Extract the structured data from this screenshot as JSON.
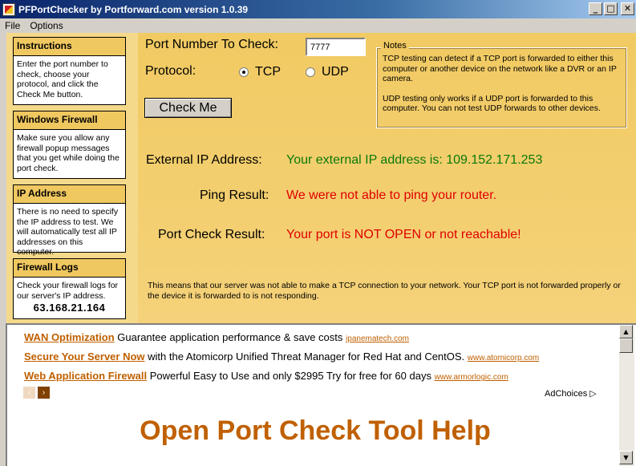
{
  "window": {
    "title": "PFPortChecker by Portforward.com version 1.0.39",
    "minimize": "_",
    "maximize": "□",
    "close": "✕"
  },
  "menu": [
    "File",
    "Options"
  ],
  "sidebar": [
    {
      "heading": "Instructions",
      "body": "Enter the port number to check, choose your protocol, and click the Check Me button."
    },
    {
      "heading": "Windows Firewall",
      "body": "Make sure you allow any firewall popup messages that you get while doing the port check."
    },
    {
      "heading": "IP Address",
      "body": "There is no need to specify the IP address to test. We will automatically test all IP addresses on this computer."
    },
    {
      "heading": "Firewall Logs",
      "body": "Check your firewall logs for our server's IP address.",
      "ip": "63.168.21.164"
    }
  ],
  "form": {
    "port_label": "Port Number To Check:",
    "port_value": "7777",
    "protocol_label": "Protocol:",
    "tcp_label": "TCP",
    "udp_label": "UDP",
    "selected_protocol": "TCP",
    "check_button": "Check Me"
  },
  "notes": {
    "title": "Notes",
    "text1": "TCP testing can detect if a TCP port is forwarded to either this computer or another device on the network like a DVR or an IP camera.",
    "text2": "UDP testing only works if a UDP port is forwarded to this computer. You can not test UDP forwards to other devices."
  },
  "results": {
    "external_ip_label": "External IP Address:",
    "external_ip_value": "Your external IP address is: 109.152.171.253",
    "ping_label": "Ping Result:",
    "ping_value": "We were not able to ping your router.",
    "port_label": "Port Check Result:",
    "port_value": "Your port is NOT OPEN or not reachable!",
    "footer": "This means that our server was not able to make a TCP connection to your network. Your TCP port is not forwarded properly or the device it is forwarded to is not responding."
  },
  "ads": [
    {
      "title": "WAN Optimization",
      "text": "Guarantee application performance & save costs",
      "url": "ipanematech.com"
    },
    {
      "title": "Secure Your Server Now",
      "text": "with the Atomicorp Unified Threat Manager for Red Hat and CentOS.",
      "url": "www.atomicorp.com"
    },
    {
      "title": "Web Application Firewall",
      "text": "Powerful Easy to Use and only $2995 Try for free for 60 days",
      "url": "www.armorlogic.com"
    }
  ],
  "ad_prev": "‹",
  "ad_next": "›",
  "adchoices": "AdChoices",
  "adchoices_icon": "▷",
  "help_title": "Open Port Check Tool Help",
  "colors": {
    "accent": "#f0c860",
    "green": "#0a7a0a",
    "red": "#e00000",
    "link": "#c06000"
  }
}
